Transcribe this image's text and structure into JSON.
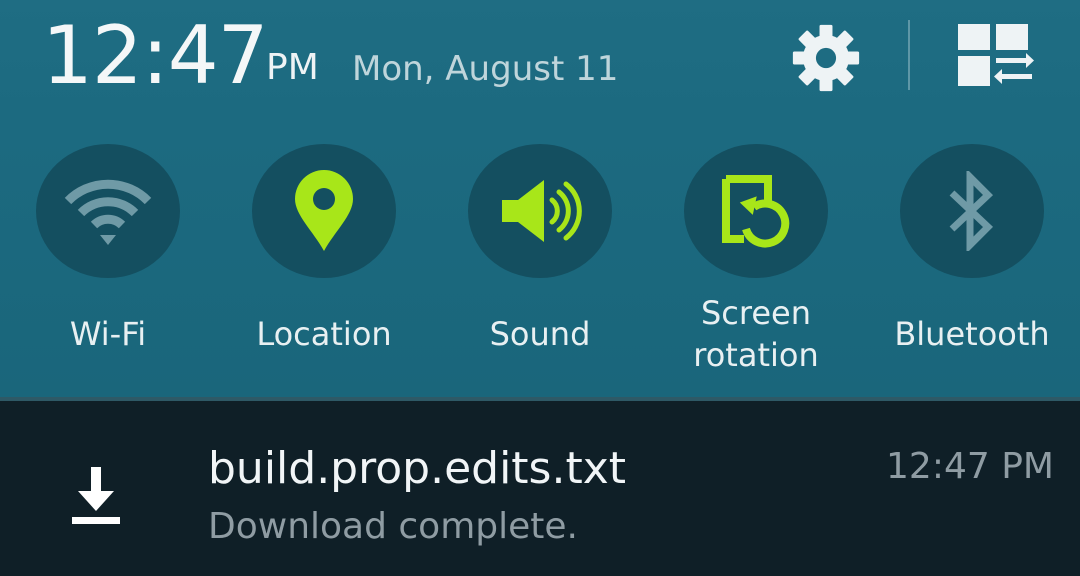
{
  "status_header": {
    "time": "12:47",
    "ampm": "PM",
    "date": "Mon, August 11",
    "settings_icon": "gear-icon",
    "edit_icon": "quick-settings-edit-icon"
  },
  "quick_settings": [
    {
      "label": "Wi-Fi",
      "icon": "wifi-icon",
      "active": false
    },
    {
      "label": "Location",
      "icon": "location-pin-icon",
      "active": true
    },
    {
      "label": "Sound",
      "icon": "speaker-icon",
      "active": true
    },
    {
      "label": "Screen rotation",
      "icon": "screen-rotation-icon",
      "active": true
    },
    {
      "label": "Bluetooth",
      "icon": "bluetooth-icon",
      "active": false
    }
  ],
  "notification": {
    "icon": "download-icon",
    "title": "build.prop.edits.txt",
    "subtitle": "Download complete.",
    "time": "12:47 PM"
  },
  "colors": {
    "shade_background": "#1c6a80",
    "tile_circle": "#144f60",
    "active_accent": "#a8e619",
    "inactive_icon": "#6f9aa6",
    "notification_background": "#0f1f27"
  }
}
